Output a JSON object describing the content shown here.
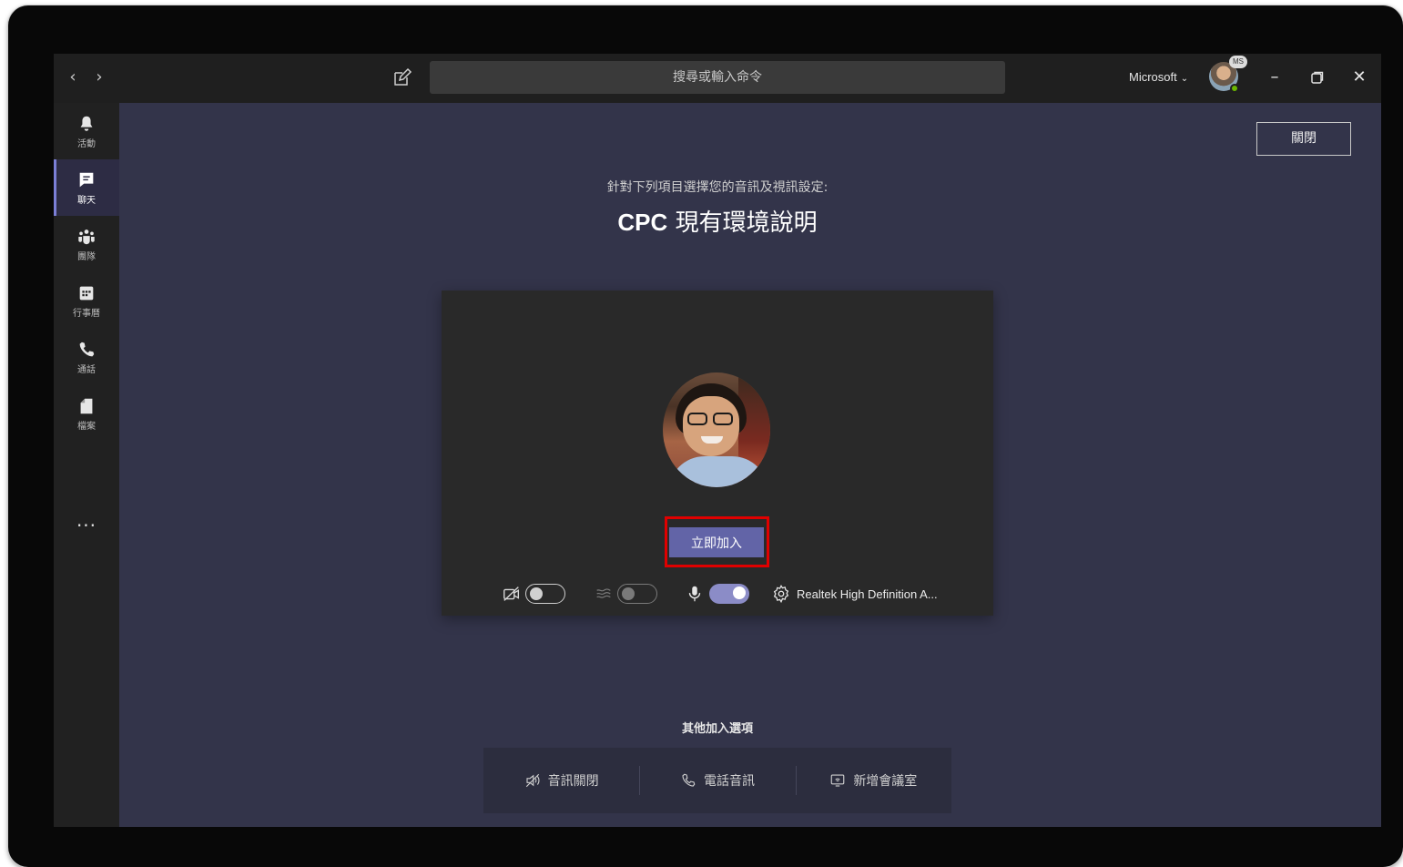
{
  "window": {
    "search_placeholder": "搜尋或輸入命令",
    "org_name": "Microsoft",
    "ms_badge": "MS"
  },
  "rail": {
    "items": [
      {
        "label": "活動"
      },
      {
        "label": "聊天"
      },
      {
        "label": "團隊"
      },
      {
        "label": "行事曆"
      },
      {
        "label": "通話"
      },
      {
        "label": "檔案"
      }
    ],
    "more": "..."
  },
  "prejoin": {
    "close_label": "關閉",
    "subtitle": "針對下列項目選擇您的音訊及視訊設定:",
    "meeting_title_prefix": "CPC",
    "meeting_title_rest": " 現有環境說明",
    "join_label": "立即加入",
    "camera_on": false,
    "blur_on": false,
    "mic_on": true,
    "audio_device": "Realtek High Definition A..."
  },
  "other_options": {
    "title": "其他加入選項",
    "items": [
      {
        "label": "音訊關閉"
      },
      {
        "label": "電話音訊"
      },
      {
        "label": "新增會議室"
      }
    ]
  },
  "colors": {
    "accent": "#6264a7",
    "highlight": "#e00000",
    "stage": "#33344a"
  }
}
